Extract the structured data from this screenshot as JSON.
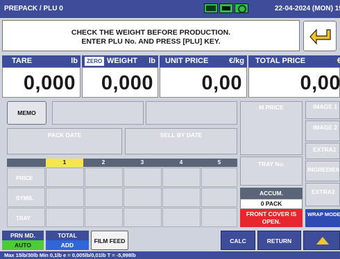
{
  "header": {
    "title": "PREPACK / PLU 0",
    "datetime": "22-04-2024 (MON) 19:"
  },
  "message": {
    "line1": "CHECK THE WEIGHT BEFORE PRODUCTION.",
    "line2": "ENTER PLU No. AND PRESS [PLU] KEY."
  },
  "fields": {
    "tare": {
      "label": "TARE",
      "unit": "lb",
      "value": "0,000"
    },
    "weight": {
      "badge": "ZERO",
      "label": "WEIGHT",
      "unit": "lb",
      "value": "0,000"
    },
    "unit_price": {
      "label": "UNIT PRICE",
      "unit": "€/kg",
      "value": "0,00"
    },
    "total_price": {
      "label": "TOTAL PRICE",
      "unit": "€",
      "value": "0,00"
    }
  },
  "buttons": {
    "memo": "MEMO",
    "pack_date": "PACK DATE",
    "sell_by_date": "SELL BY DATE",
    "m_price": "M PRICE",
    "tray_no": "TRAY No.",
    "image1": "IMAGE 1",
    "image2": "IMAGE 2",
    "extra1": "EXTRA1",
    "ingredients": "INGREDIEN",
    "extra3": "EXTRA3",
    "wrap_mode": "WRAP MODE",
    "prn_md": "PRN MD.",
    "prn_md_value": "AUTO",
    "total": "TOTAL",
    "total_value": "ADD",
    "film_feed": "FILM FEED",
    "calc": "CALC",
    "return": "RETURN"
  },
  "tray_table": {
    "columns": [
      "1",
      "2",
      "3",
      "4",
      "5"
    ],
    "rows": [
      "PRICE",
      "SYMB.",
      "TRAY"
    ]
  },
  "status": {
    "accum": "ACCUM.",
    "pack": "0 PACK",
    "cover_line1": "FRONT COVER IS",
    "cover_line2": "OPEN."
  },
  "footer": "Max 15lb/30lb  Min 0,1lb  e = 0,005lb/0,01lb  T = -5,998lb",
  "colors": {
    "header": "#3d4d99",
    "selected_tab": "#f5e64a",
    "auto": "#4dcc3a",
    "add": "#2f66d8",
    "alert": "#e8262d"
  }
}
